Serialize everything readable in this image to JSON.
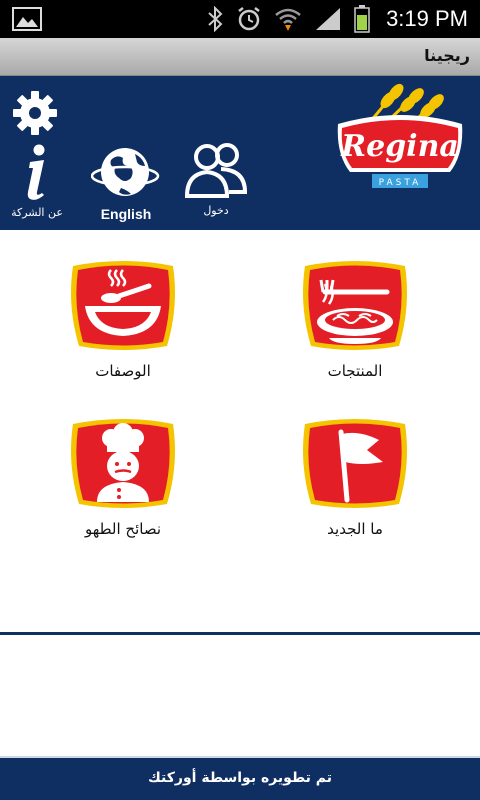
{
  "status_bar": {
    "time": "3:19 PM"
  },
  "app_bar": {
    "title": "ريجينا"
  },
  "header": {
    "about_label": "عن الشركة",
    "language_label": "English",
    "login_label": "دخول",
    "logo_text": "Regina",
    "logo_subtext": "PASTA"
  },
  "menu": {
    "products_label": "المنتجات",
    "recipes_label": "الوصفات",
    "news_label": "ما الجديد",
    "tips_label": "نصائح الطهو"
  },
  "footer": {
    "credit": "تم تطويره بواسطة أوركتك"
  },
  "colors": {
    "navy": "#0f2e61",
    "red": "#e41e26",
    "gold": "#f5c400"
  }
}
